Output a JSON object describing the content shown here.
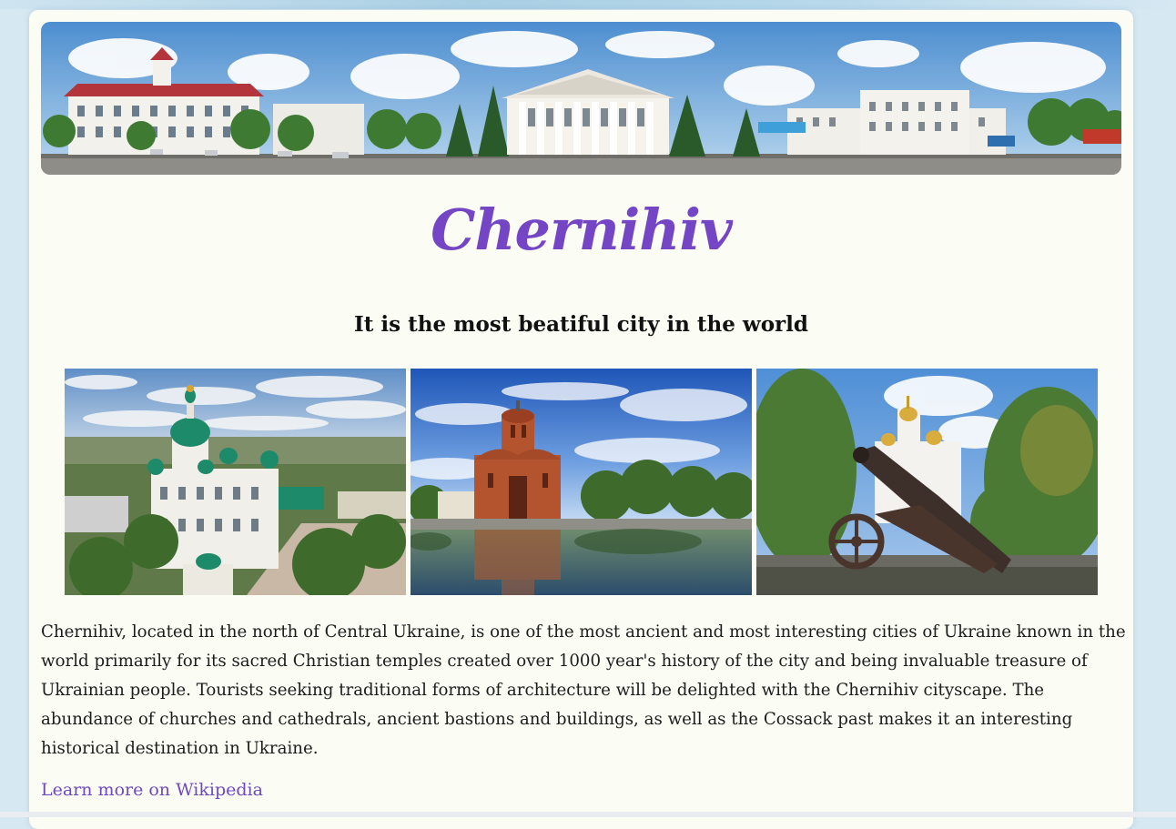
{
  "page": {
    "title": "Chernihiv",
    "subtitle": "It is the most beatiful city in the world",
    "description": "Chernihiv, located in the north of Central Ukraine, is one of the most ancient and most interesting cities of Ukraine known in the world primarily for its sacred Christian temples created over 1000 year's history of the city and being invaluable treasure of Ukrainian people. Tourists seeking traditional forms of architecture will be delighted with the Chernihiv cityscape. The abundance of churches and cathedrals, ancient bastions and buildings, as well as the Cossack past makes it an interesting historical destination in Ukraine.",
    "link_text": "Learn more on Wikipedia"
  },
  "colors": {
    "title": "#7445c4",
    "link": "#6e49bf",
    "card_background": "#fbfcf4",
    "page_background": "#d6e8f2"
  },
  "images": [
    {
      "name": "city-panorama-banner"
    },
    {
      "name": "monastery-photo"
    },
    {
      "name": "red-brick-church-photo"
    },
    {
      "name": "cannon-photo"
    }
  ]
}
